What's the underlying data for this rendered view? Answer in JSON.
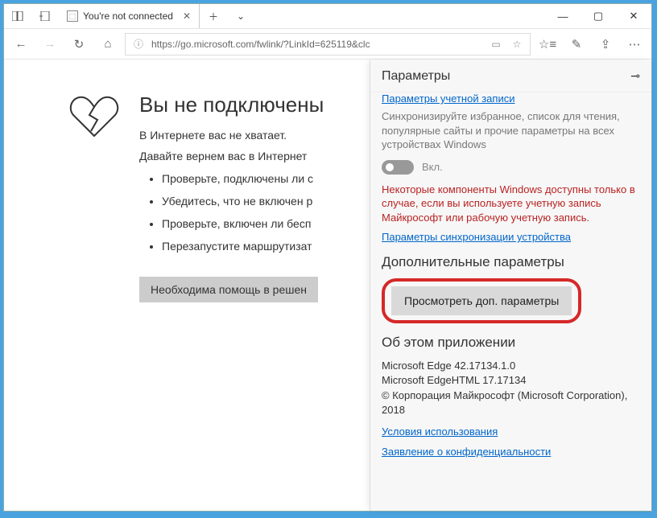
{
  "titlebar": {
    "tab_title": "You're not connected"
  },
  "addressbar": {
    "url": "https://go.microsoft.com/fwlink/?LinkId=625119&clc"
  },
  "error_page": {
    "heading": "Вы не подключены",
    "sub1": "В Интернете вас не хватает.",
    "sub2": "Давайте вернем вас в Интернет",
    "bullets": [
      "Проверьте, подключены ли с",
      "Убедитесь, что не включен р",
      "Проверьте, включен ли бесп",
      "Перезапустите маршрутизат"
    ],
    "help_btn": "Необходима помощь в решен"
  },
  "panel": {
    "title": "Параметры",
    "account_link": "Параметры учетной записи",
    "sync_note": "Синхронизируйте избранное, список для чтения, популярные сайты и прочие параметры на всех устройствах Windows",
    "toggle_label": "Вкл.",
    "warn_text": "Некоторые компоненты Windows доступны только в случае, если вы используете учетную запись Майкрософт или рабочую учетную запись.",
    "sync_device_link": "Параметры синхронизации устройства",
    "adv_heading": "Дополнительные параметры",
    "adv_button": "Просмотреть доп. параметры",
    "about_heading": "Об этом приложении",
    "about": {
      "line1": "Microsoft Edge 42.17134.1.0",
      "line2": "Microsoft EdgeHTML 17.17134",
      "line3": "© Корпорация Майкрософт (Microsoft Corporation), 2018"
    },
    "terms_link": "Условия использования",
    "privacy_link": "Заявление о конфиденциальности"
  }
}
